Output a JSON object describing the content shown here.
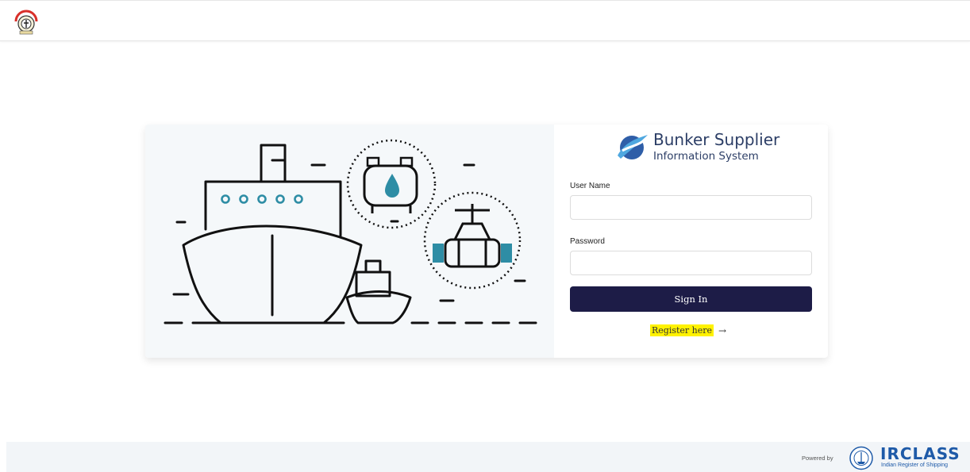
{
  "header": {
    "logo_icon": "organization-seal-logo"
  },
  "illustration": {
    "icons": [
      "cargo-ship-icon",
      "tug-boat-icon",
      "fuel-tank-icon",
      "pipeline-valve-icon"
    ],
    "colors": {
      "line": "#111111",
      "accent": "#2e8da5",
      "background": "#f5f8fa"
    }
  },
  "brand": {
    "title": "Bunker Supplier",
    "subtitle": "Information System",
    "icon": "swoosh-logo-icon"
  },
  "login": {
    "username_label": "User Name",
    "username_value": "",
    "password_label": "Password",
    "password_value": "",
    "signin_label": "Sign In",
    "register_label": "Register here",
    "register_arrow": "→",
    "signin_color": "#1d1c47",
    "highlight_color": "#fff200"
  },
  "footer": {
    "powered_by": "Powered by",
    "org_name": "IRCLASS",
    "org_sub": "Indian Register of Shipping",
    "org_color": "#1e5aa8"
  }
}
